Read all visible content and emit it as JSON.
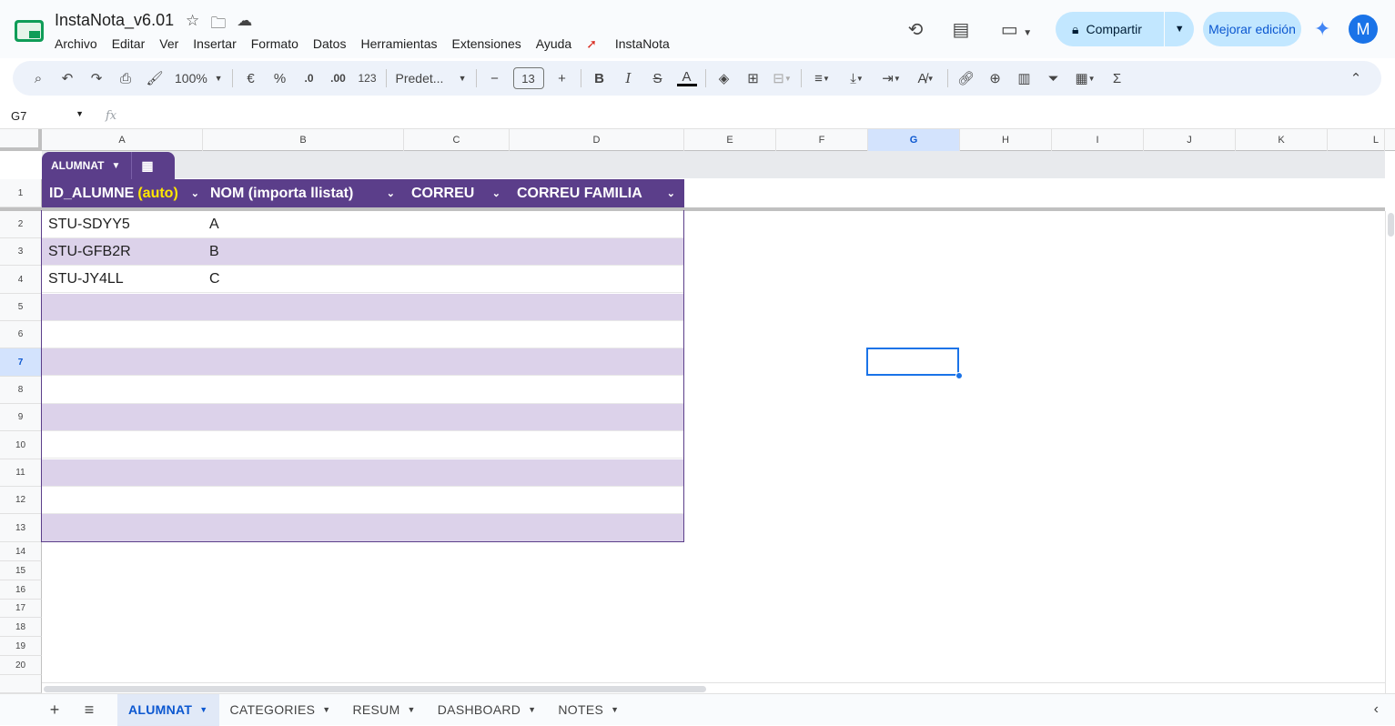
{
  "doc": {
    "title": "InstaNota_v6.01",
    "menus": [
      "Archivo",
      "Editar",
      "Ver",
      "Insertar",
      "Formato",
      "Datos",
      "Herramientas",
      "Extensiones",
      "Ayuda",
      "InstaNota"
    ]
  },
  "header_right": {
    "share_label": "Compartir",
    "improve_label": "Mejorar edición",
    "avatar_letter": "M"
  },
  "toolbar": {
    "zoom": "100%",
    "currency": "€",
    "percent": "%",
    "dec_less": ".0",
    "dec_more": ".00",
    "number_format": "123",
    "font_name": "Predet...",
    "font_size": "13",
    "bold": "B",
    "italic": "I",
    "strike": "S",
    "text_color": "A",
    "sum": "Σ"
  },
  "formula_bar": {
    "cell_ref": "G7",
    "fx": "fx",
    "value": ""
  },
  "columns": [
    "A",
    "B",
    "C",
    "D",
    "E",
    "F",
    "G",
    "H",
    "I",
    "J",
    "K",
    "L"
  ],
  "rows": [
    "1",
    "2",
    "3",
    "4",
    "5",
    "6",
    "7",
    "8",
    "9",
    "10",
    "11",
    "12",
    "13",
    "14",
    "15",
    "16",
    "17",
    "18",
    "19",
    "20"
  ],
  "table": {
    "name": "ALUMNAT",
    "headers": [
      {
        "label": "ID_ALUMNE",
        "suffix": "(auto)"
      },
      {
        "label": "NOM (importa llistat)",
        "suffix": ""
      },
      {
        "label": "CORREU",
        "suffix": ""
      },
      {
        "label": "CORREU FAMILIA",
        "suffix": ""
      }
    ],
    "rows": [
      [
        "STU-SDYY5",
        "A",
        "",
        ""
      ],
      [
        "STU-GFB2R",
        "B",
        "",
        ""
      ],
      [
        "STU-JY4LL",
        "C",
        "",
        ""
      ],
      [
        "",
        "",
        "",
        ""
      ],
      [
        "",
        "",
        "",
        ""
      ],
      [
        "",
        "",
        "",
        ""
      ],
      [
        "",
        "",
        "",
        ""
      ],
      [
        "",
        "",
        "",
        ""
      ],
      [
        "",
        "",
        "",
        ""
      ],
      [
        "",
        "",
        "",
        ""
      ],
      [
        "",
        "",
        "",
        ""
      ],
      [
        "",
        "",
        "",
        ""
      ]
    ]
  },
  "sheets": [
    {
      "label": "ALUMNAT",
      "active": true
    },
    {
      "label": "CATEGORIES",
      "active": false
    },
    {
      "label": "RESUM",
      "active": false
    },
    {
      "label": "DASHBOARD",
      "active": false
    },
    {
      "label": "NOTES",
      "active": false
    }
  ],
  "colors": {
    "table_header": "#5b3e8a",
    "band": "#dcd2ea",
    "auto_highlight": "#ffe600",
    "accent": "#1a73e8"
  }
}
